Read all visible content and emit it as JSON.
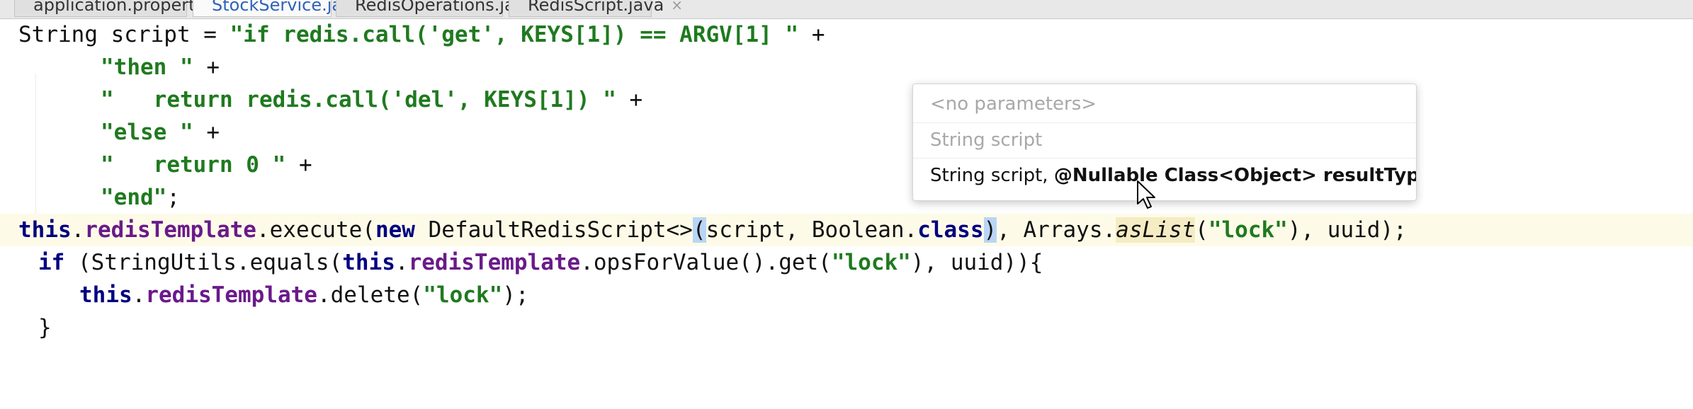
{
  "tabs": [
    {
      "label": "application.properties",
      "icon": "properties-file-icon"
    },
    {
      "label": "StockService.java",
      "icon": "java-class-icon",
      "active": true
    },
    {
      "label": "RedisOperations.java",
      "icon": "java-class-icon"
    },
    {
      "label": "RedisScript.java",
      "icon": "java-class-icon"
    }
  ],
  "tab_close_glyph": "×",
  "code": {
    "l1": {
      "a": "String script = ",
      "b": "\"if redis.call('get', KEYS[1]) == ARGV[1] \"",
      "c": " +"
    },
    "l2": {
      "a": "\"then \"",
      "b": " +"
    },
    "l3": {
      "a": "\"   return redis.call('del', KEYS[1]) \"",
      "b": " +"
    },
    "l4": {
      "a": "\"else \"",
      "b": " +"
    },
    "l5": {
      "a": "\"   return 0 \"",
      "b": " +"
    },
    "l6": {
      "a": "\"end\"",
      "b": ";"
    },
    "l7": {
      "this": "this",
      "dot1": ".",
      "field": "redisTemplate",
      "t1": ".execute(",
      "new": "new",
      "t2": " DefaultRedisScript<>",
      "lp": "(",
      "t3": "script, Boolean.",
      "cls": "class",
      "rp": ")",
      "t4": ", Arrays.",
      "aslist": "asList",
      "t5": "(",
      "s1": "\"lock\"",
      "t6": "), uuid);"
    },
    "l8": {
      "if": "if",
      "t1": " (StringUtils.equals(",
      "this": "this",
      "t2": ".",
      "field": "redisTemplate",
      "t3": ".opsForValue().get(",
      "s1": "\"lock\"",
      "t4": "), uuid)){"
    },
    "l9": {
      "this": "this",
      "t1": ".",
      "field": "redisTemplate",
      "t2": ".delete(",
      "s1": "\"lock\"",
      "t3": ");"
    },
    "l10": {
      "a": "}"
    }
  },
  "parameter_info": {
    "row1": "<no parameters>",
    "row2": "String script",
    "row3_a": "String script, ",
    "row3_b": "@Nullable Class",
    "row3_c": "<Object>",
    "row3_d": " resultType"
  },
  "colors": {
    "string": "#1f7a1f",
    "keyword": "#000080",
    "field": "#6a1a8a",
    "current_line": "#fdfbe8",
    "paren_highlight": "#b9d5f5"
  }
}
